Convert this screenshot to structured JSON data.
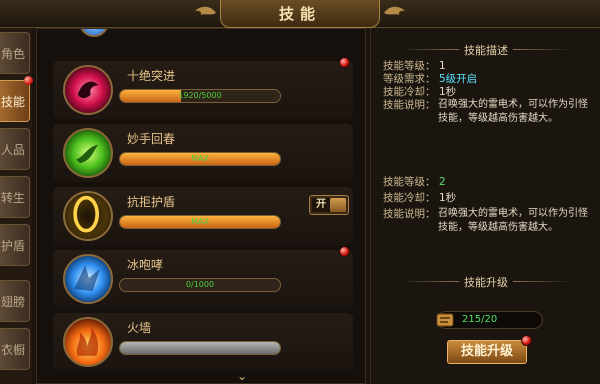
{
  "header": {
    "title": "技能"
  },
  "sidebar": {
    "tabs": [
      {
        "label": "角色",
        "active": false
      },
      {
        "label": "技能",
        "active": true
      },
      {
        "label": "人品",
        "active": false
      },
      {
        "label": "转生",
        "active": false
      },
      {
        "label": "护盾",
        "active": false
      },
      {
        "label": "翅膀",
        "active": false
      },
      {
        "label": "衣橱",
        "active": false
      }
    ]
  },
  "skills": [
    {
      "name": "十绝突进",
      "progress_text": "1920/5000",
      "progress": 0.384,
      "bar_style": "orange",
      "has_alert": true,
      "icon": "dragon-fist-icon"
    },
    {
      "name": "妙手回春",
      "progress_text": "MAX",
      "progress": 1.0,
      "bar_style": "orange",
      "has_alert": false,
      "icon": "healing-vine-icon"
    },
    {
      "name": "抗拒护盾",
      "progress_text": "MAX",
      "progress": 1.0,
      "bar_style": "orange",
      "has_alert": false,
      "icon": "golden-shield-icon",
      "toggle_label": "开"
    },
    {
      "name": "冰咆哮",
      "progress_text": "0/1000",
      "progress": 0.0,
      "bar_style": "orange",
      "has_alert": true,
      "icon": "ice-roar-icon"
    },
    {
      "name": "火墙",
      "progress_text": "",
      "progress": 1.0,
      "bar_style": "gray",
      "has_alert": false,
      "icon": "fire-wall-icon"
    }
  ],
  "detail": {
    "section_title": "技能描述",
    "current": {
      "level_label": "技能等级：",
      "level_value": "1",
      "req_label": "等级需求：",
      "req_value": "5级开启",
      "cooldown_label": "技能冷却：",
      "cooldown_value": "1秒",
      "desc_label": "技能说明：",
      "desc_value": "召唤强大的雷电术，可以作为引怪技能，等级越高伤害越大。"
    },
    "next": {
      "level_label": "技能等级：",
      "level_value": "2",
      "cooldown_label": "技能冷却：",
      "cooldown_value": "1秒",
      "desc_label": "技能说明：",
      "desc_value": "召唤强大的雷电术，可以作为引怪技能，等级越高伤害越大。"
    },
    "upgrade_section_title": "技能升级",
    "cost_text": "215/20",
    "upgrade_button_label": "技能升级"
  },
  "colors": {
    "accent_orange": "#c86418",
    "gold_border": "#a88345",
    "alert_red": "#d4140e"
  }
}
